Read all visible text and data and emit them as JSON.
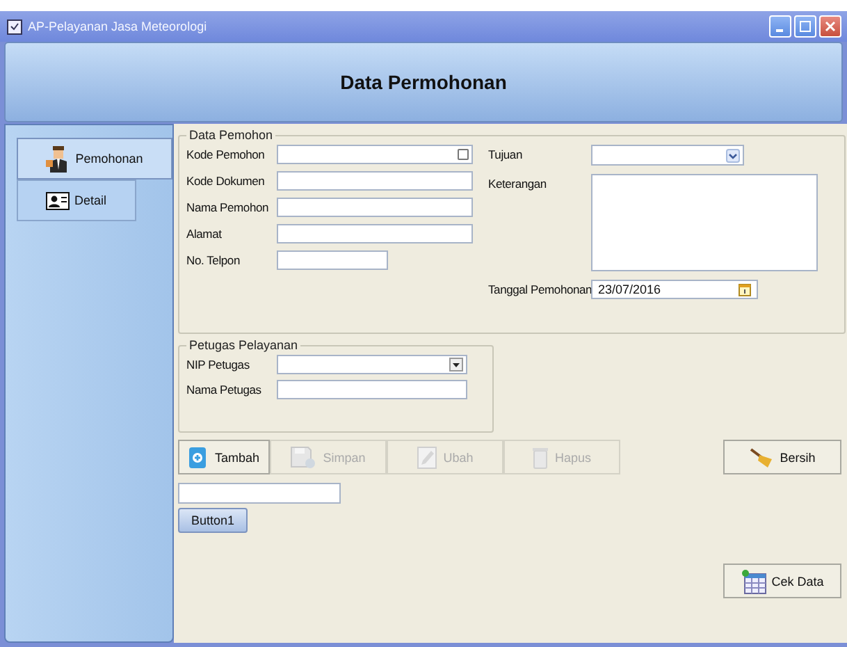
{
  "window": {
    "title": "AP-Pelayanan Jasa Meteorologi"
  },
  "header": {
    "title": "Data Permohonan"
  },
  "sidebar": {
    "items": [
      {
        "label": "Pemohonan",
        "selected": true
      },
      {
        "label": "Detail",
        "selected": false
      }
    ]
  },
  "data_pemohon": {
    "title": "Data Pemohon",
    "left_fields": [
      {
        "label": "Kode Pemohon",
        "kind": "lookup"
      },
      {
        "label": "Kode Dokumen",
        "kind": "text"
      },
      {
        "label": "Nama Pemohon",
        "kind": "text"
      },
      {
        "label": "Alamat",
        "kind": "text"
      },
      {
        "label": "No. Telpon",
        "kind": "short"
      }
    ],
    "right_fields": [
      {
        "label": "Tujuan",
        "kind": "combo"
      },
      {
        "label": "Keterangan",
        "kind": "textarea"
      },
      {
        "label": "Tanggal Pemohonan",
        "kind": "date",
        "value": "23/07/2016"
      }
    ]
  },
  "petugas": {
    "title": "Petugas Pelayanan",
    "fields": [
      {
        "label": "NIP Petugas",
        "kind": "dropdown"
      },
      {
        "label": "Nama Petugas",
        "kind": "text"
      }
    ]
  },
  "toolbar": [
    {
      "label": "Tambah",
      "disabled": false
    },
    {
      "label": "Simpan",
      "disabled": true
    },
    {
      "label": "Ubah",
      "disabled": true
    },
    {
      "label": "Hapus",
      "disabled": true
    }
  ],
  "clear_button": {
    "label": "Bersih"
  },
  "extra_button": {
    "label": "Button1"
  },
  "check_button": {
    "label": "Cek Data"
  }
}
